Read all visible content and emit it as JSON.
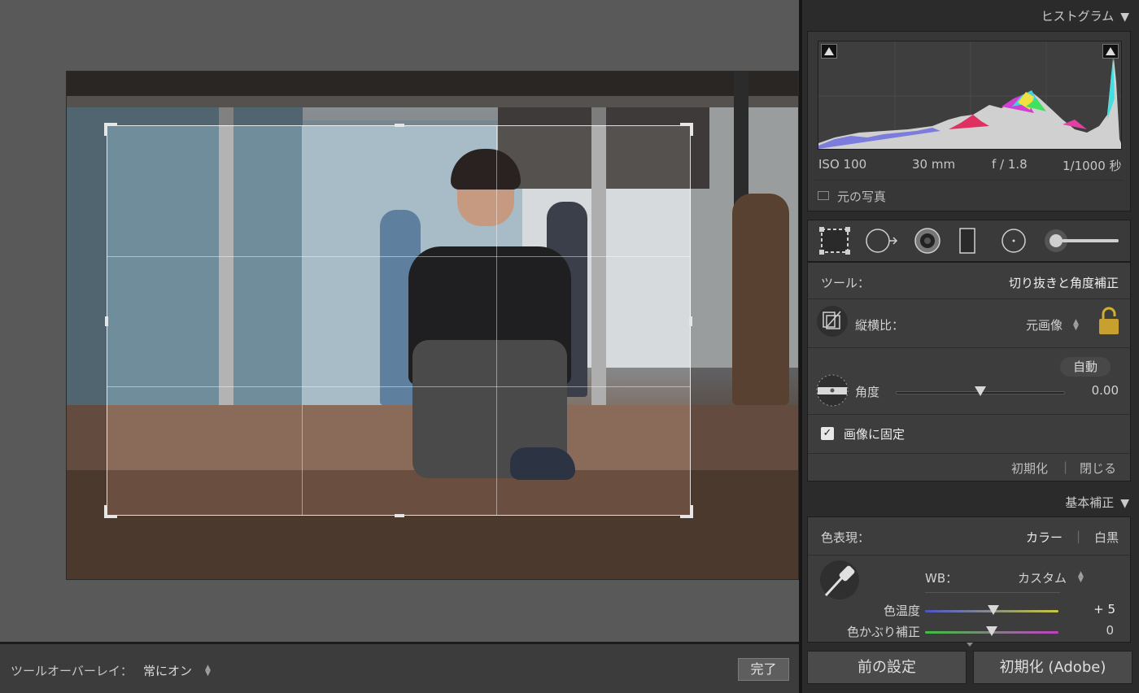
{
  "overlay": {
    "label": "ツールオーバーレイ：",
    "value": "常にオン"
  },
  "done_button": "完了",
  "histogram": {
    "header": "ヒストグラム",
    "exif": {
      "iso": "ISO 100",
      "focal": "30 mm",
      "aperture": "f / 1.8",
      "shutter": "1/1000 秒"
    },
    "original_photo": "元の写真"
  },
  "tools": {
    "icons": [
      "crop-overlay-icon",
      "spot-removal-icon",
      "red-eye-icon",
      "graduated-filter-icon",
      "radial-filter-icon",
      "adjustment-brush-icon"
    ],
    "tool_label": "ツール：",
    "tool_value": "切り抜きと角度補正",
    "aspect_label": "縦横比：",
    "aspect_value": "元画像",
    "auto_button": "自動",
    "angle_label": "角度",
    "angle_value": "0.00",
    "angle_level": 0.5,
    "lock_to_image": "画像に固定",
    "reset": "初期化",
    "close": "閉じる"
  },
  "basic": {
    "header": "基本補正",
    "treatment_label": "色表現：",
    "treatment_color": "カラー",
    "treatment_bw": "白黒",
    "wb_label": "WB：",
    "wb_value": "カスタム",
    "temp_label": "色温度",
    "temp_value": "+ 5",
    "temp_level": 0.51,
    "tint_label": "色かぶり補正",
    "tint_value": "0",
    "tint_level": 0.5
  },
  "footer": {
    "previous": "前の設定",
    "reset_adobe": "初期化 (Adobe)"
  },
  "colors": {
    "panel": "#2b2b2b",
    "box": "#3d3d3d",
    "canvas": "#595959"
  }
}
